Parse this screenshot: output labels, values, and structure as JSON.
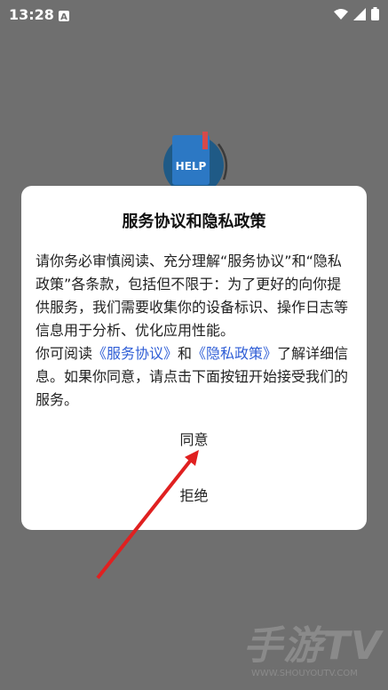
{
  "status_bar": {
    "time": "13:28",
    "app_icon": "A"
  },
  "logo": {
    "text": "HELP"
  },
  "dialog": {
    "title": "服务协议和隐私政策",
    "body_part1": "请你务必审慎阅读、充分理解“服务协议”和“隐私政策”各条款，包括但不限于：为了更好的向你提供服务，我们需要收集你的设备标识、操作日志等信息用于分析、优化应用性能。",
    "body_part2_prefix": "你可阅读",
    "link_service": "《服务协议》",
    "body_and": "和",
    "link_privacy": "《隐私政策》",
    "body_part2_suffix": "了解详细信息。如果你同意，请点击下面按钮开始接受我们的服务。",
    "agree_label": "同意",
    "decline_label": "拒绝"
  },
  "watermark": {
    "main": "手游TV",
    "url": "WWW.SHOUYOUTV.COM"
  },
  "colors": {
    "overlay": "#6f6f6f",
    "link": "#2f5ed6",
    "arrow": "#e02020"
  }
}
